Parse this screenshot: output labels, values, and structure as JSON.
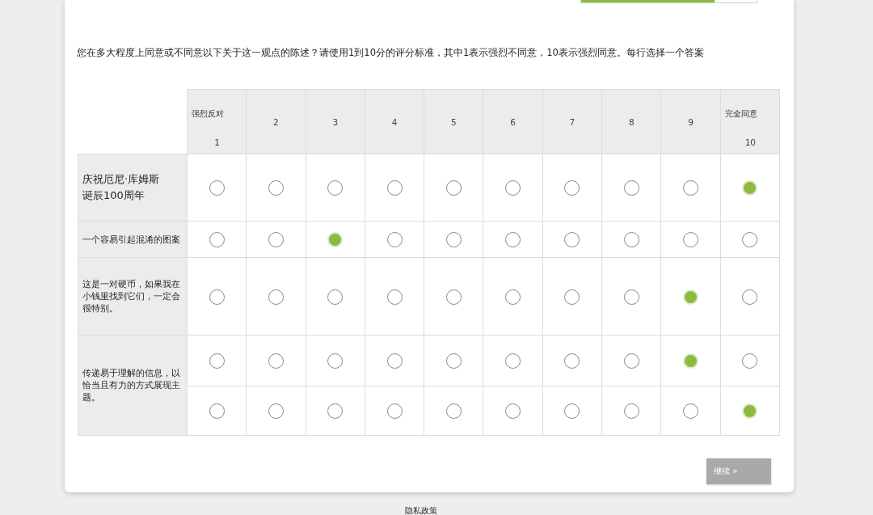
{
  "progress": {
    "level": 0.76
  },
  "question": "您在多大程度上同意或不同意以下关于这一观点的陈述？请使用1到10分的评分标准，其中1表示强烈不同意，10表示强烈同意。每行选择一个答案",
  "scale": [
    {
      "label": "强烈反对",
      "value": "1"
    },
    {
      "value": "2"
    },
    {
      "value": "3"
    },
    {
      "value": "4"
    },
    {
      "value": "5"
    },
    {
      "value": "6"
    },
    {
      "value": "7"
    },
    {
      "value": "8"
    },
    {
      "value": "9"
    },
    {
      "label": "完全同意",
      "value": "10"
    }
  ],
  "statements": [
    {
      "kind": "headline",
      "label": "庆祝厄尼·库姆斯诞辰100周年",
      "lines": [
        [
          {
            "selected": false
          },
          {
            "selected": false
          },
          {
            "selected": false
          },
          {
            "selected": false
          },
          {
            "selected": false
          },
          {
            "selected": false
          },
          {
            "selected": false
          },
          {
            "selected": false
          },
          {
            "selected": false
          },
          {
            "selected": true
          }
        ]
      ]
    },
    {
      "kind": "text",
      "label": "一个容易引起混淆的图案",
      "lines": [
        [
          {
            "selected": false
          },
          {
            "selected": false
          },
          {
            "selected": true
          },
          {
            "selected": false
          },
          {
            "selected": false
          },
          {
            "selected": false
          },
          {
            "selected": false
          },
          {
            "selected": false
          },
          {
            "selected": false
          },
          {
            "selected": false
          }
        ]
      ]
    },
    {
      "kind": "text",
      "label": "这是一对硬币，如果我在小钱里找到它们，一定会很特别。",
      "lines": [
        [
          {
            "selected": false
          },
          {
            "selected": false
          },
          {
            "selected": false
          },
          {
            "selected": false
          },
          {
            "selected": false
          },
          {
            "selected": false
          },
          {
            "selected": false
          },
          {
            "selected": false
          },
          {
            "selected": true
          },
          {
            "selected": false
          }
        ]
      ]
    },
    {
      "kind": "text",
      "label": "传递易于理解的信息，以恰当且有力的方式展现主题。",
      "lines": [
        [
          {
            "selected": false
          },
          {
            "selected": false
          },
          {
            "selected": false
          },
          {
            "selected": false
          },
          {
            "selected": false
          },
          {
            "selected": false
          },
          {
            "selected": false
          },
          {
            "selected": false
          },
          {
            "selected": true
          },
          {
            "selected": false
          }
        ],
        [
          {
            "selected": false
          },
          {
            "selected": false
          },
          {
            "selected": false
          },
          {
            "selected": false
          },
          {
            "selected": false
          },
          {
            "selected": false
          },
          {
            "selected": false
          },
          {
            "selected": false
          },
          {
            "selected": false
          },
          {
            "selected": true
          }
        ]
      ]
    }
  ],
  "buttons": [
    {
      "label": "继续 »"
    }
  ],
  "footer": {
    "links": [
      "隐私政策"
    ]
  }
}
